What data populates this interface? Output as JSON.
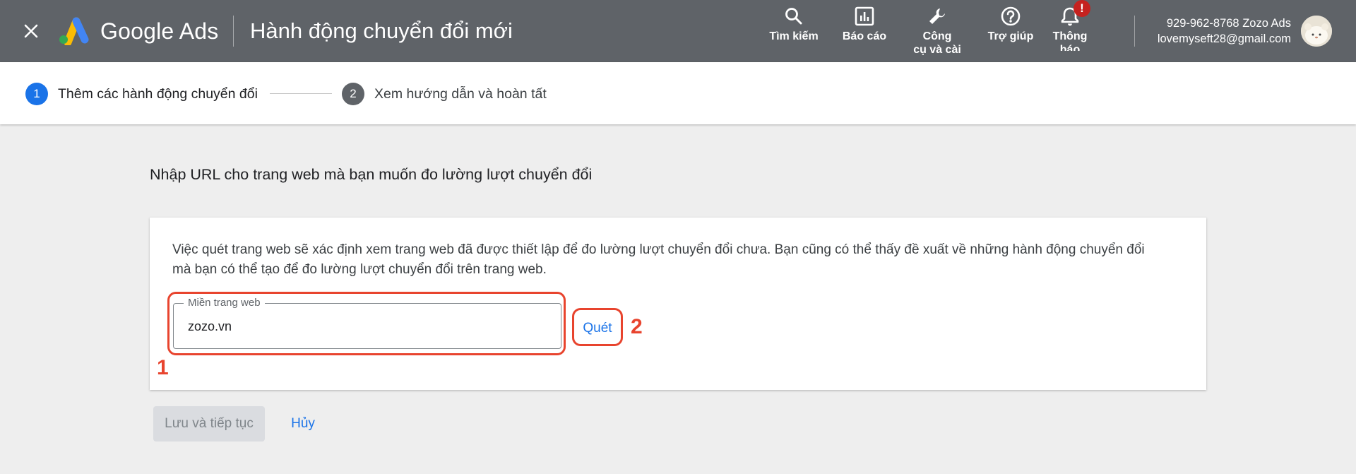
{
  "header": {
    "brand": "Google Ads",
    "title": "Hành động chuyển đổi mới",
    "nav": [
      {
        "label": "Tìm kiếm",
        "icon": "search-icon"
      },
      {
        "label": "Báo cáo",
        "icon": "reports-icon"
      },
      {
        "label_line1": "Công",
        "label_line2": "cụ và cài",
        "icon": "wrench-icon"
      },
      {
        "label": "Trợ giúp",
        "icon": "help-icon"
      },
      {
        "label_line1": "Thông",
        "label_line2": "báo",
        "icon": "bell-icon",
        "badge": "!"
      }
    ],
    "account": {
      "line1": "929-962-8768 Zozo Ads",
      "line2": "lovemyseft28@gmail.com"
    }
  },
  "stepper": {
    "steps": [
      {
        "number": "1",
        "label": "Thêm các hành động chuyển đổi",
        "active": true
      },
      {
        "number": "2",
        "label": "Xem hướng dẫn và hoàn tất",
        "active": false
      }
    ]
  },
  "main": {
    "heading": "Nhập URL cho trang web mà bạn muốn đo lường lượt chuyển đổi",
    "card": {
      "description": "Việc quét trang web sẽ xác định xem trang web đã được thiết lập để đo lường lượt chuyển đổi chưa. Bạn cũng có thể thấy đề xuất về những hành động chuyển đổi mà bạn có thể tạo để đo lường lượt chuyển đổi trên trang web.",
      "field_label": "Miền trang web",
      "field_value": "zozo.vn",
      "scan_label": "Quét"
    },
    "annotations": [
      "1",
      "2"
    ],
    "buttons": {
      "save": "Lưu và tiếp tục",
      "cancel": "Hủy"
    }
  },
  "colors": {
    "topbar": "#5f6368",
    "accent": "#1a73e8",
    "annotation": "#e8442e",
    "badge": "#c5221f"
  }
}
